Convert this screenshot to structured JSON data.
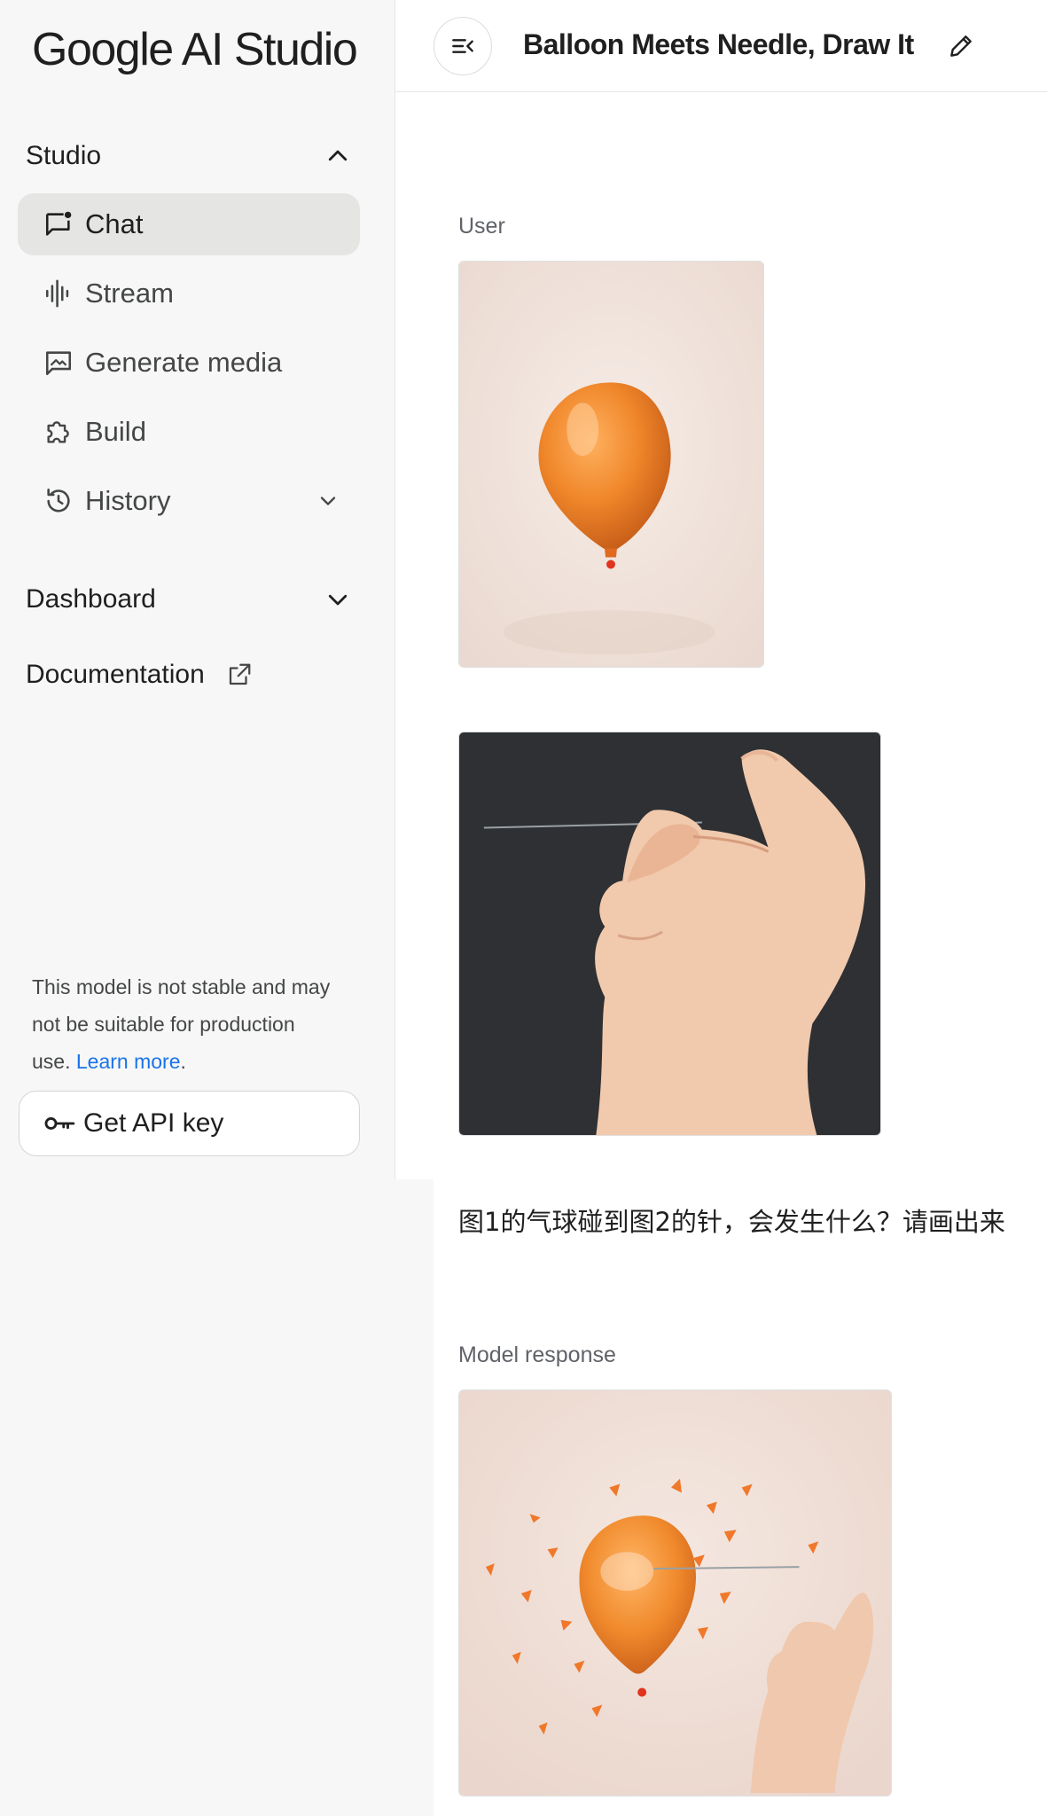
{
  "app": {
    "logo_text": "Google AI Studio"
  },
  "sidebar": {
    "studio": {
      "label": "Studio",
      "icon": "chevron-up-icon"
    },
    "items": [
      {
        "label": "Chat",
        "icon": "chat-icon",
        "active": true
      },
      {
        "label": "Stream",
        "icon": "waveform-icon"
      },
      {
        "label": "Generate media",
        "icon": "image-icon"
      },
      {
        "label": "Build",
        "icon": "puzzle-icon"
      },
      {
        "label": "History",
        "icon": "history-icon",
        "tail_icon": "chevron-down-icon"
      }
    ],
    "dashboard": {
      "label": "Dashboard",
      "icon": "chevron-down-icon"
    },
    "documentation": {
      "label": "Documentation",
      "icon": "external-link-icon"
    },
    "notice": {
      "text": "This model is not stable and may not be suitable for production use.",
      "link": "Learn more",
      "suffix": "."
    },
    "api_button": {
      "label": "Get API key",
      "icon": "key-icon"
    }
  },
  "header": {
    "title": "Balloon Meets Needle, Draw It",
    "toggle_icon": "collapse-sidebar-icon",
    "edit_icon": "pencil-icon"
  },
  "chat": {
    "user_label": "User",
    "prompt": "图1的气球碰到图2的针，会发生什么？请画出来",
    "model_label": "Model response"
  },
  "colors": {
    "accent_link": "#1a73e8",
    "sidebar_bg": "#f7f7f7",
    "active_item_bg": "#e5e5e4",
    "balloon_orange": "#f08a2c"
  }
}
